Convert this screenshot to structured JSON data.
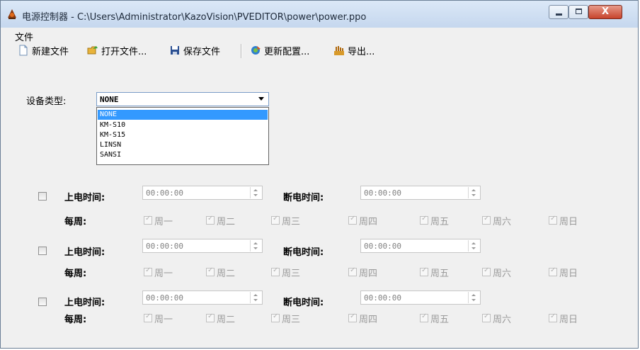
{
  "window": {
    "title": "电源控制器 - C:\\Users\\Administrator\\KazoVision\\PVEDITOR\\power\\power.ppo",
    "close_label": "X"
  },
  "menu": {
    "file": "文件"
  },
  "toolbar": {
    "new_file": "新建文件",
    "open_file": "打开文件...",
    "save_file": "保存文件",
    "update_config": "更新配置...",
    "export": "导出..."
  },
  "device": {
    "label": "设备类型:",
    "selected": "NONE",
    "options": [
      "NONE",
      "KM-S10",
      "KM-S15",
      "LINSN",
      "SANSI"
    ]
  },
  "schedule_labels": {
    "power_on": "上电时间:",
    "power_off": "断电时间:",
    "weekly": "每周:"
  },
  "schedules": [
    {
      "enabled": false,
      "on_time": "00:00:00",
      "off_time": "00:00:00",
      "days": [
        "周一",
        "周二",
        "周三",
        "周四",
        "周五",
        "周六",
        "周日"
      ]
    },
    {
      "enabled": false,
      "on_time": "00:00:00",
      "off_time": "00:00:00",
      "days": [
        "周一",
        "周二",
        "周三",
        "周四",
        "周五",
        "周六",
        "周日"
      ]
    },
    {
      "enabled": false,
      "on_time": "00:00:00",
      "off_time": "00:00:00",
      "days": [
        "周一",
        "周二",
        "周三",
        "周四",
        "周五",
        "周六",
        "周日"
      ]
    }
  ],
  "colors": {
    "selection": "#3399ff",
    "titlebar": "#c5d7ee",
    "close_button": "#c7442c"
  }
}
